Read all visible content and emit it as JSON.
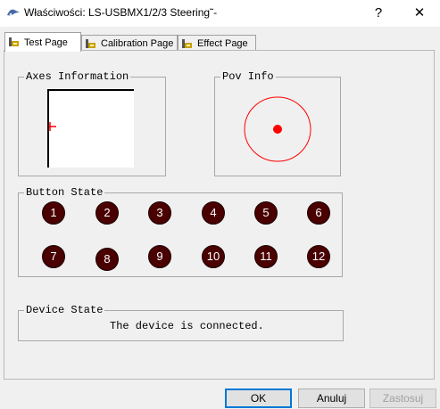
{
  "window": {
    "title": "Właściwości: LS-USBMX1/2/3 Steering˜-",
    "help_glyph": "?",
    "close_glyph": "✕"
  },
  "tabs": [
    {
      "label": "Test Page",
      "active": true
    },
    {
      "label": "Calibration Page",
      "active": false
    },
    {
      "label": "Effect Page",
      "active": false
    }
  ],
  "axes": {
    "title": "Axes Information"
  },
  "pov": {
    "title": "Pov Info",
    "color": "#ff0000"
  },
  "buttons": {
    "title": "Button State",
    "labels": [
      "1",
      "2",
      "3",
      "4",
      "5",
      "6",
      "7",
      "8",
      "9",
      "10",
      "11",
      "12"
    ],
    "color": "#4a0000"
  },
  "device": {
    "title": "Device State",
    "status": "The device is connected."
  },
  "footer": {
    "ok": "OK",
    "cancel": "Anuluj",
    "apply": "Zastosuj"
  },
  "colors": {
    "accent": "#0078d7"
  }
}
